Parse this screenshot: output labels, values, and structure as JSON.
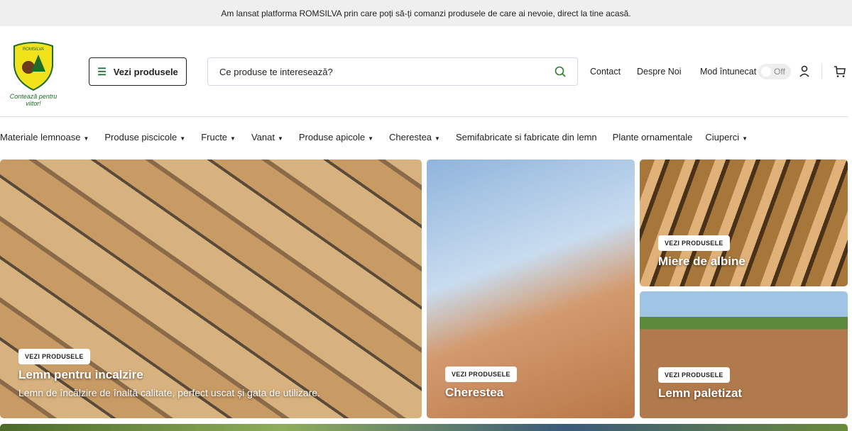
{
  "banner": "Am lansat platforma ROMSILVA prin care poți să-ți comanzi produsele de care ai nevoie, direct la tine acasă.",
  "logo": {
    "text": "ROMSILVA",
    "slogan": "Contează pentru viitor!"
  },
  "header": {
    "products_button": "Vezi produsele",
    "search_placeholder": "Ce produse te interesează?",
    "contact": "Contact",
    "about": "Despre Noi",
    "dark_mode": "Mod întunecat",
    "toggle_state": "Off"
  },
  "categories": [
    "Materiale lemnoase",
    "Produse piscicole",
    "Fructe",
    "Vanat",
    "Produse apicole",
    "Cherestea",
    "Semifabricate si fabricate din lemn",
    "Plante ornamentale",
    "Ciuperci"
  ],
  "tiles": {
    "cta": "VEZI PRODUSELE",
    "firewood": {
      "title": "Lemn pentru incalzire",
      "subtitle": "Lemn de încălzire de înaltă calitate, perfect uscat și gata de utilizare."
    },
    "lumber": {
      "title": "Cherestea"
    },
    "honey": {
      "title": "Miere de albine"
    },
    "pallet": {
      "title": "Lemn paletizat"
    }
  }
}
